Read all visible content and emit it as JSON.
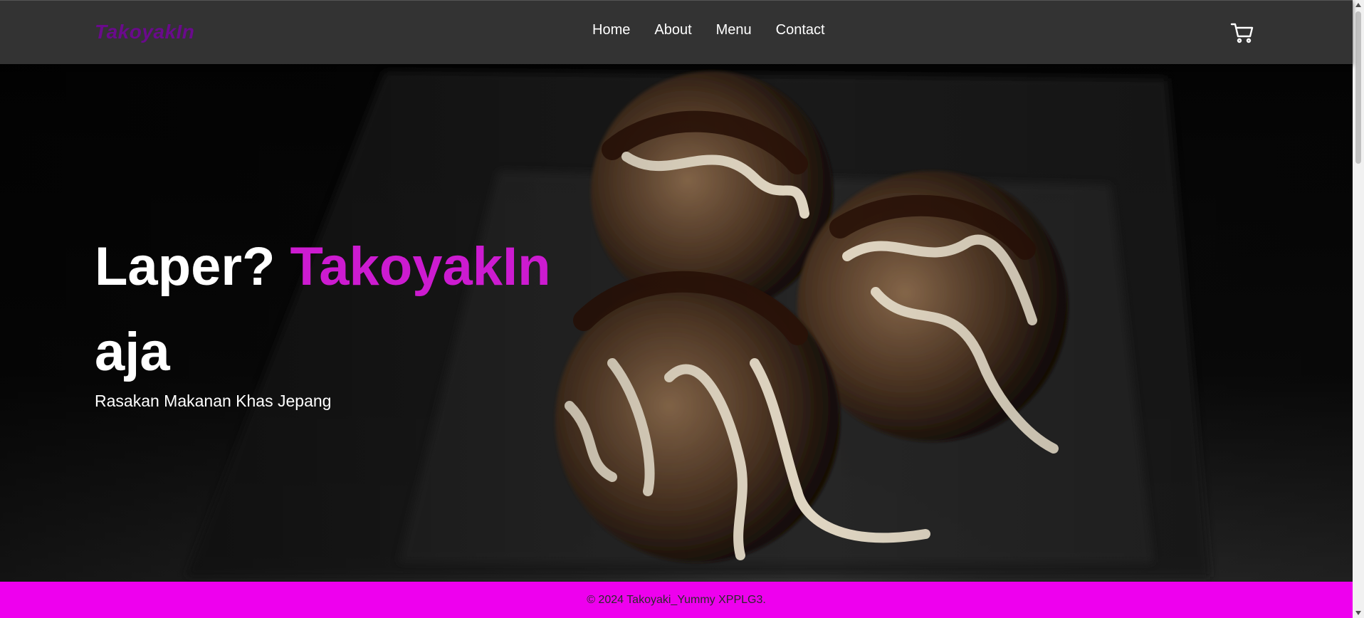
{
  "navbar": {
    "logo": "TakoyakIn",
    "links": [
      {
        "label": "Home"
      },
      {
        "label": "About"
      },
      {
        "label": "Menu"
      },
      {
        "label": "Contact"
      }
    ],
    "cart_icon": "cart-icon"
  },
  "hero": {
    "title_lead": "Laper? ",
    "title_accent": "TakoyakIn",
    "title_tail": "aja",
    "subtitle": "Rasakan Makanan Khas Jepang"
  },
  "footer": {
    "text": "© 2024 Takoyaki_Yummy XPPLG3."
  },
  "colors": {
    "navbar_bg": "#333333",
    "logo": "#6a0a8c",
    "accent": "#cc1bd0",
    "footer_bg": "#ee00ee"
  }
}
